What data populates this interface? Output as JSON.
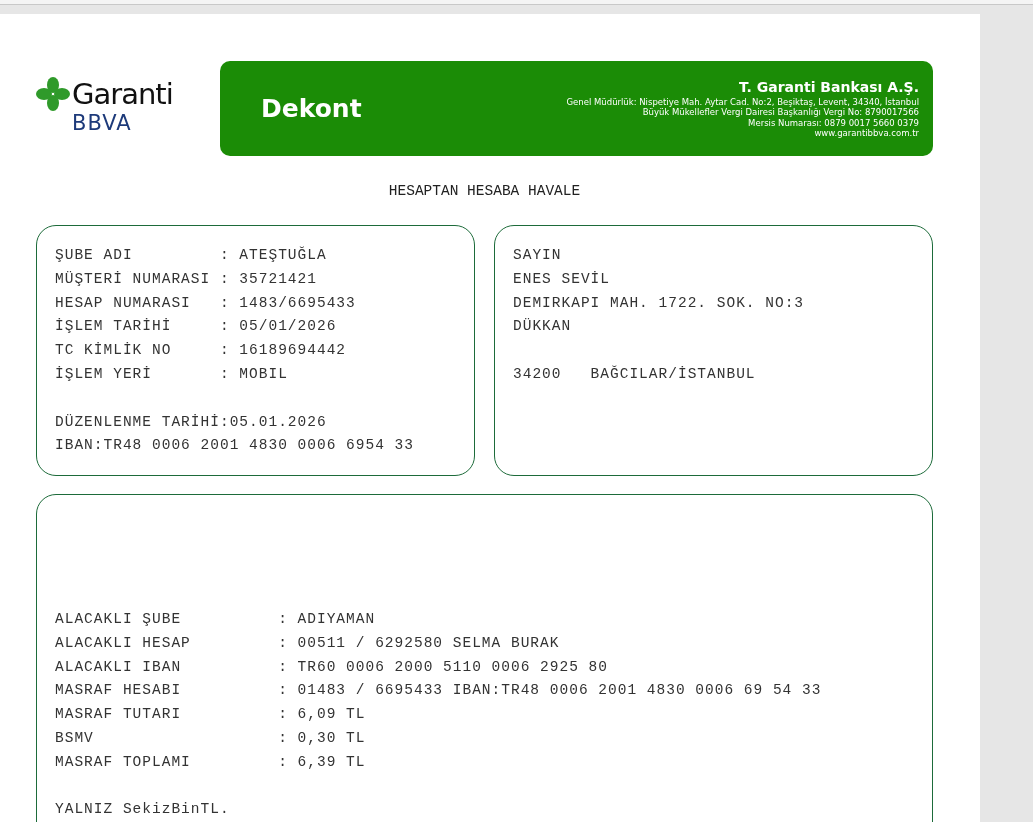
{
  "logo": {
    "name": "Garanti",
    "sub": "BBVA"
  },
  "banner": {
    "title": "Dekont",
    "bank": "T. Garanti Bankası A.Ş.",
    "lines": [
      "Genel Müdürlük: Nispetiye Mah. Aytar Cad. No:2, Beşiktaş, Levent, 34340, İstanbul",
      "Büyük Mükellefler Vergi Dairesi Başkanlığı Vergi No: 8790017566",
      "Mersis Numarası: 0879 0017 5660 0379",
      "www.garantibbva.com.tr"
    ]
  },
  "heading": "HESAPTAN HESABA HAVALE",
  "account_box": {
    "blocks": [
      [
        "ŞUBE ADI         : ATEŞTUĞLA",
        "MÜŞTERİ NUMARASI : 35721421",
        "HESAP NUMARASI   : 1483/6695433",
        "İŞLEM TARİHİ     : 05/01/2026",
        "TC KİMLİK NO     : 16189694442",
        "İŞLEM YERİ       : MOBIL"
      ],
      [
        "DÜZENLENME TARİHİ:05.01.2026",
        "IBAN:TR48 0006 2001 4830 0006 6954 33"
      ]
    ]
  },
  "address_box": {
    "blocks": [
      [
        "SAYIN",
        "ENES SEVİL",
        "DEMIRKAPI MAH. 1722. SOK. NO:3",
        "DÜKKAN"
      ],
      [
        "34200   BAĞCILAR/İSTANBUL"
      ]
    ]
  },
  "details_box": {
    "blocks": [
      [
        "ALACAKLI ŞUBE          : ADIYAMAN",
        "ALACAKLI HESAP         : 00511 / 6292580 SELMA BURAK",
        "ALACAKLI IBAN          : TR60 0006 2000 5110 0006 2925 80",
        "MASRAF HESABI          : 01483 / 6695433 IBAN:TR48 0006 2001 4830 0006 69 54 33",
        "MASRAF TUTARI          : 6,09 TL",
        "BSMV                   : 0,30 TL",
        "MASRAF TOPLAMI         : 6,39 TL"
      ],
      [
        "YALNIZ SekizBinTL."
      ]
    ]
  }
}
